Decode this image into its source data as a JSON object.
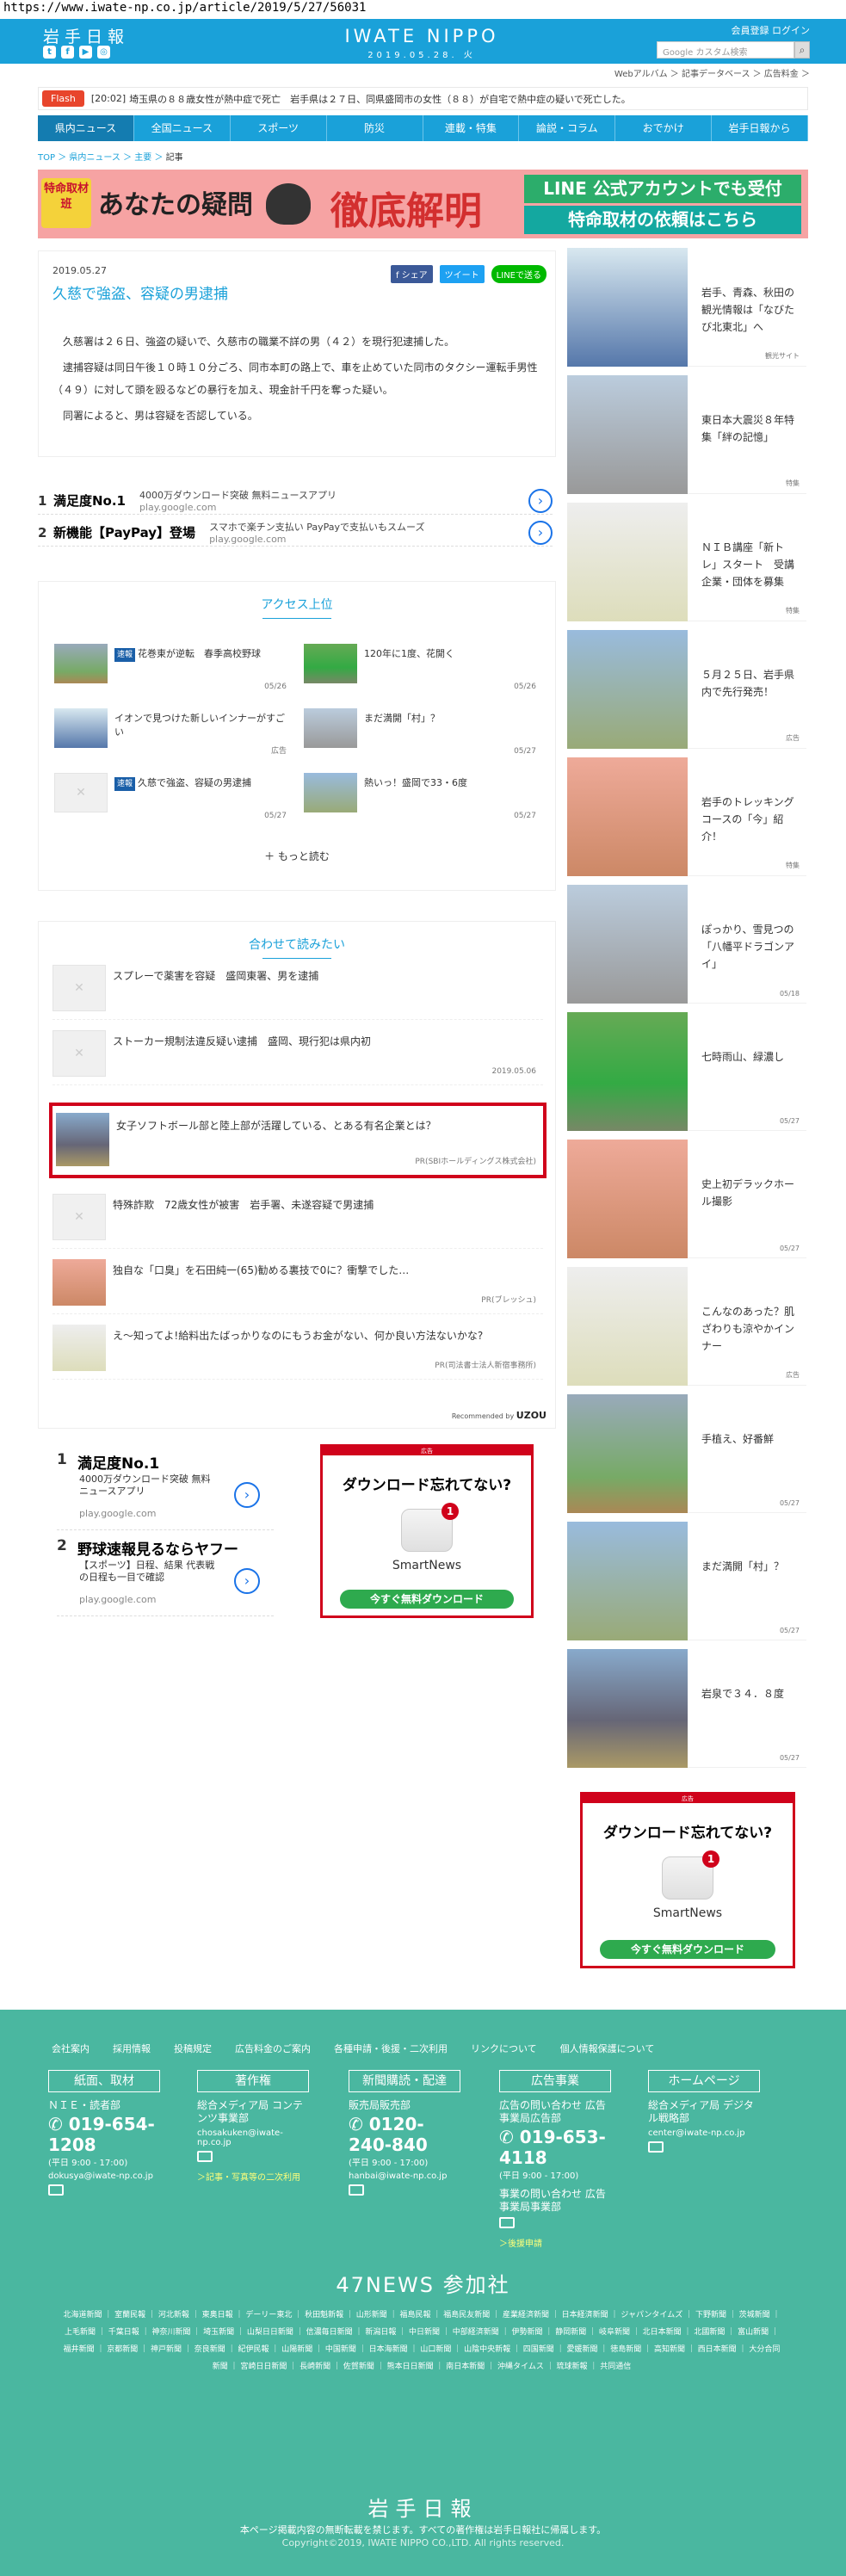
{
  "url": "https://www.iwate-np.co.jp/article/2019/5/27/56031",
  "header": {
    "logo_jp": "岩手日報",
    "brand": "IWATE NIPPO",
    "date": "2019.05.28. 火",
    "member_links": "会員登録 ログイン",
    "search_placeholder": "Google カスタム検索",
    "sublinks": "Webアルバム ＞  記事データベース ＞  広告料金 ＞",
    "social_icons": [
      "twitter-icon",
      "facebook-icon",
      "youtube-icon",
      "instagram-icon"
    ]
  },
  "flash": {
    "label": "Flash",
    "time": "[20:02]",
    "text": "埼玉県の８８歳女性が熱中症で死亡　岩手県は２７日、同県盛岡市の女性（８８）が自宅で熱中症の疑いで死亡した。"
  },
  "nav": [
    "県内ニュース",
    "全国ニュース",
    "スポーツ",
    "防災",
    "連載・特集",
    "論説・コラム",
    "おでかけ",
    "岩手日報から"
  ],
  "breadcrumb": {
    "top": "TOP",
    "sep": "＞",
    "c1": "県内ニュース",
    "c2": "主要",
    "current": "記事"
  },
  "banner": {
    "badge": "特命取材班",
    "question": "あなたの疑問",
    "headline": "徹底解明",
    "line1": "LINE 公式アカウントでも受付",
    "line2": "特命取材の依頼はこちら"
  },
  "article": {
    "date": "2019.05.27",
    "title": "久慈で強盗、容疑の男逮捕",
    "share": [
      "f シェア",
      "ツイート",
      "LINEで送る"
    ],
    "paragraphs": [
      "久慈署は２６日、強盗の疑いで、久慈市の職業不詳の男（４２）を現行犯逮捕した。",
      "逮捕容疑は同日午後１０時１０分ごろ、同市本町の路上で、車を止めていた同市のタクシー運転手男性（４９）に対して頭を殴るなどの暴行を加え、現金計千円を奪った疑い。",
      "同署によると、男は容疑を否認している。"
    ]
  },
  "text_ads": [
    {
      "num": "1",
      "title": "満足度No.1",
      "sub": "4000万ダウンロード突破 無料ニュースアプリ",
      "domain": "play.google.com"
    },
    {
      "num": "2",
      "title": "新機能【PayPay】登場",
      "sub": "スマホで楽チン支払い PayPayで支払いもスムーズ",
      "domain": "play.google.com"
    }
  ],
  "ranking": {
    "title": "アクセス上位",
    "more": "もっと読む",
    "items": [
      {
        "tag": "速報",
        "text": "花巻東が逆転　春季高校野球",
        "date": "05/26"
      },
      {
        "tag": "",
        "text": "120年に1度、花開く",
        "date": "05/26"
      },
      {
        "tag": "",
        "text": "イオンで見つけた新しいインナーがすごい",
        "date": "広告"
      },
      {
        "tag": "",
        "text": "まだ満開「村」？",
        "date": "05/27"
      },
      {
        "tag": "速報",
        "text": "久慈で強盗、容疑の男逮捕",
        "date": "05/27"
      },
      {
        "tag": "",
        "text": "熱いっ！盛岡で33・6度",
        "date": "05/27"
      }
    ]
  },
  "related": {
    "title": "合わせて読みたい",
    "items": [
      {
        "text": "スプレーで薬害を容疑　盛岡東署、男を逮捕",
        "meta": ""
      },
      {
        "text": "ストーカー規制法違反疑い逮捕　盛岡、現行犯は県内初",
        "meta": "2019.05.06"
      },
      {
        "text": "女子ソフトボール部と陸上部が活躍している、とある有名企業とは？",
        "meta": "PR(SBIホールディングス株式会社)"
      },
      {
        "text": "特殊詐欺　72歳女性が被害　岩手署、未遂容疑で男逮捕",
        "meta": ""
      },
      {
        "text": "独自な「口臭」を石田純一(65)勧める裏技で0に？衝撃でした…",
        "meta": "PR(ブレッシュ)"
      },
      {
        "text": "え～知ってよ!給料出たばっかりなのにもうお金がない、何か良い方法ないかな?",
        "meta": "PR(司法書士法人新宿事務所)"
      }
    ],
    "recommend": "Recommended by",
    "recommend_brand": "UZOU"
  },
  "google_ads": [
    {
      "num": "1",
      "title": "満足度No.1",
      "sub": "4000万ダウンロード突破 無料ニュースアプリ",
      "domain": "play.google.com"
    },
    {
      "num": "2",
      "title": "野球速報見るならヤフー",
      "sub": "【スポーツ】日程、結果 代表戦の日程も一目で確認",
      "domain": "play.google.com"
    }
  ],
  "smartnews_ad": {
    "label": "広告",
    "question": "ダウンロード忘れてない?",
    "badge": "1",
    "name": "SmartNews",
    "cta": "今すぐ無料ダウンロード"
  },
  "sidebar": [
    {
      "text": "岩手、青森、秋田の観光情報は「なびたび北東北」へ",
      "meta": "観光サイト"
    },
    {
      "text": "東日本大震災８年特集「絆の記憶」",
      "meta": "特集"
    },
    {
      "text": "ＮＩＢ講座「新トレ」スタート　受講企業・団体を募集",
      "meta": "特集"
    },
    {
      "text": "５月２５日、岩手県内で先行発売！",
      "meta": "広告"
    },
    {
      "text": "岩手のトレッキングコースの「今」紹介！",
      "meta": "特集"
    },
    {
      "text": "ぽっかり、雪見つの「八幡平ドラゴンアイ」",
      "meta": "05/18"
    },
    {
      "text": "七時雨山、緑濃し",
      "meta": "05/27"
    },
    {
      "text": "史上初デラックホール撮影",
      "meta": "05/27"
    },
    {
      "text": "こんなのあった？肌ざわりも涼やかインナー",
      "meta": "広告"
    },
    {
      "text": "手植え、好番鮮",
      "meta": "05/27"
    },
    {
      "text": "まだ満開「村」？",
      "meta": "05/27"
    },
    {
      "text": "岩泉で３４．８度",
      "meta": "05/27"
    }
  ],
  "footer": {
    "links": [
      "会社案内",
      "採用情報",
      "投稿規定",
      "広告料金のご案内",
      "各種申請・後援・二次利用",
      "リンクについて",
      "個人情報保護について"
    ],
    "cols": [
      {
        "head": "紙面、取材",
        "l1": "ＮＩＥ・読者部",
        "tel": "019-654-1208",
        "hours": "(平日 9:00 - 17:00)",
        "mail": "dokusya@iwate-np.co.jp",
        "extra": ""
      },
      {
        "head": "著作権",
        "l1": "総合メディア局 コンテンツ事業部",
        "tel": "",
        "hours": "",
        "mail": "chosakuken@iwate-np.co.jp",
        "extra": "＞記事・写真等の二次利用"
      },
      {
        "head": "新聞購読・配達",
        "l1": "販売局販売部",
        "tel": "0120-240-840",
        "hours": "(平日 9:00 - 17:00)",
        "mail": "hanbai@iwate-np.co.jp",
        "extra": ""
      },
      {
        "head": "広告事業",
        "l1": "広告の問い合わせ 広告事業局広告部",
        "tel": "019-653-4118",
        "hours": "(平日 9:00 - 17:00)",
        "mail": "事業の問い合わせ 広告事業局事業部",
        "extra": "＞後援申請"
      },
      {
        "head": "ホームページ",
        "l1": "総合メディア局 デジタル戦略部",
        "tel": "",
        "hours": "",
        "mail": "center@iwate-np.co.jp",
        "extra": ""
      }
    ],
    "news47": "47NEWS 参加社",
    "papers": "北海道新聞 ｜ 室蘭民報 ｜ 河北新報 ｜ 東奥日報 ｜ デーリー東北 ｜ 秋田魁新報 ｜ 山形新聞 ｜ 福島民報 ｜ 福島民友新聞 ｜ 産業経済新聞 ｜ 日本経済新聞 ｜ ジャパンタイムズ ｜ 下野新聞 ｜ 茨城新聞 ｜ 上毛新聞 ｜ 千葉日報 ｜ 神奈川新聞 ｜ 埼玉新聞 ｜ 山梨日日新聞 ｜ 信濃毎日新聞 ｜ 新潟日報 ｜ 中日新聞 ｜ 中部経済新聞 ｜ 伊勢新聞 ｜ 静岡新聞 ｜ 岐阜新聞 ｜ 北日本新聞 ｜ 北國新聞 ｜ 富山新聞 ｜ 福井新聞 ｜ 京都新聞 ｜ 神戸新聞 ｜ 奈良新聞 ｜ 紀伊民報 ｜ 山陽新聞 ｜ 中国新聞 ｜ 日本海新聞 ｜ 山口新聞 ｜ 山陰中央新報 ｜ 四国新聞 ｜ 愛媛新聞 ｜ 徳島新聞 ｜ 高知新聞 ｜ 西日本新聞 ｜ 大分合同新聞 ｜ 宮崎日日新聞 ｜ 長崎新聞 ｜ 佐賀新聞 ｜ 熊本日日新聞 ｜ 南日本新聞 ｜ 沖縄タイムス ｜ 琉球新報 ｜ 共同通信",
    "logo": "岩手日報",
    "note": "本ページ掲載内容の無断転載を禁じます。すべての著作権は岩手日報社に帰属します。",
    "copyright": "Copyright©2019, IWATE NIPPO CO.,LTD. All rights reserved."
  }
}
